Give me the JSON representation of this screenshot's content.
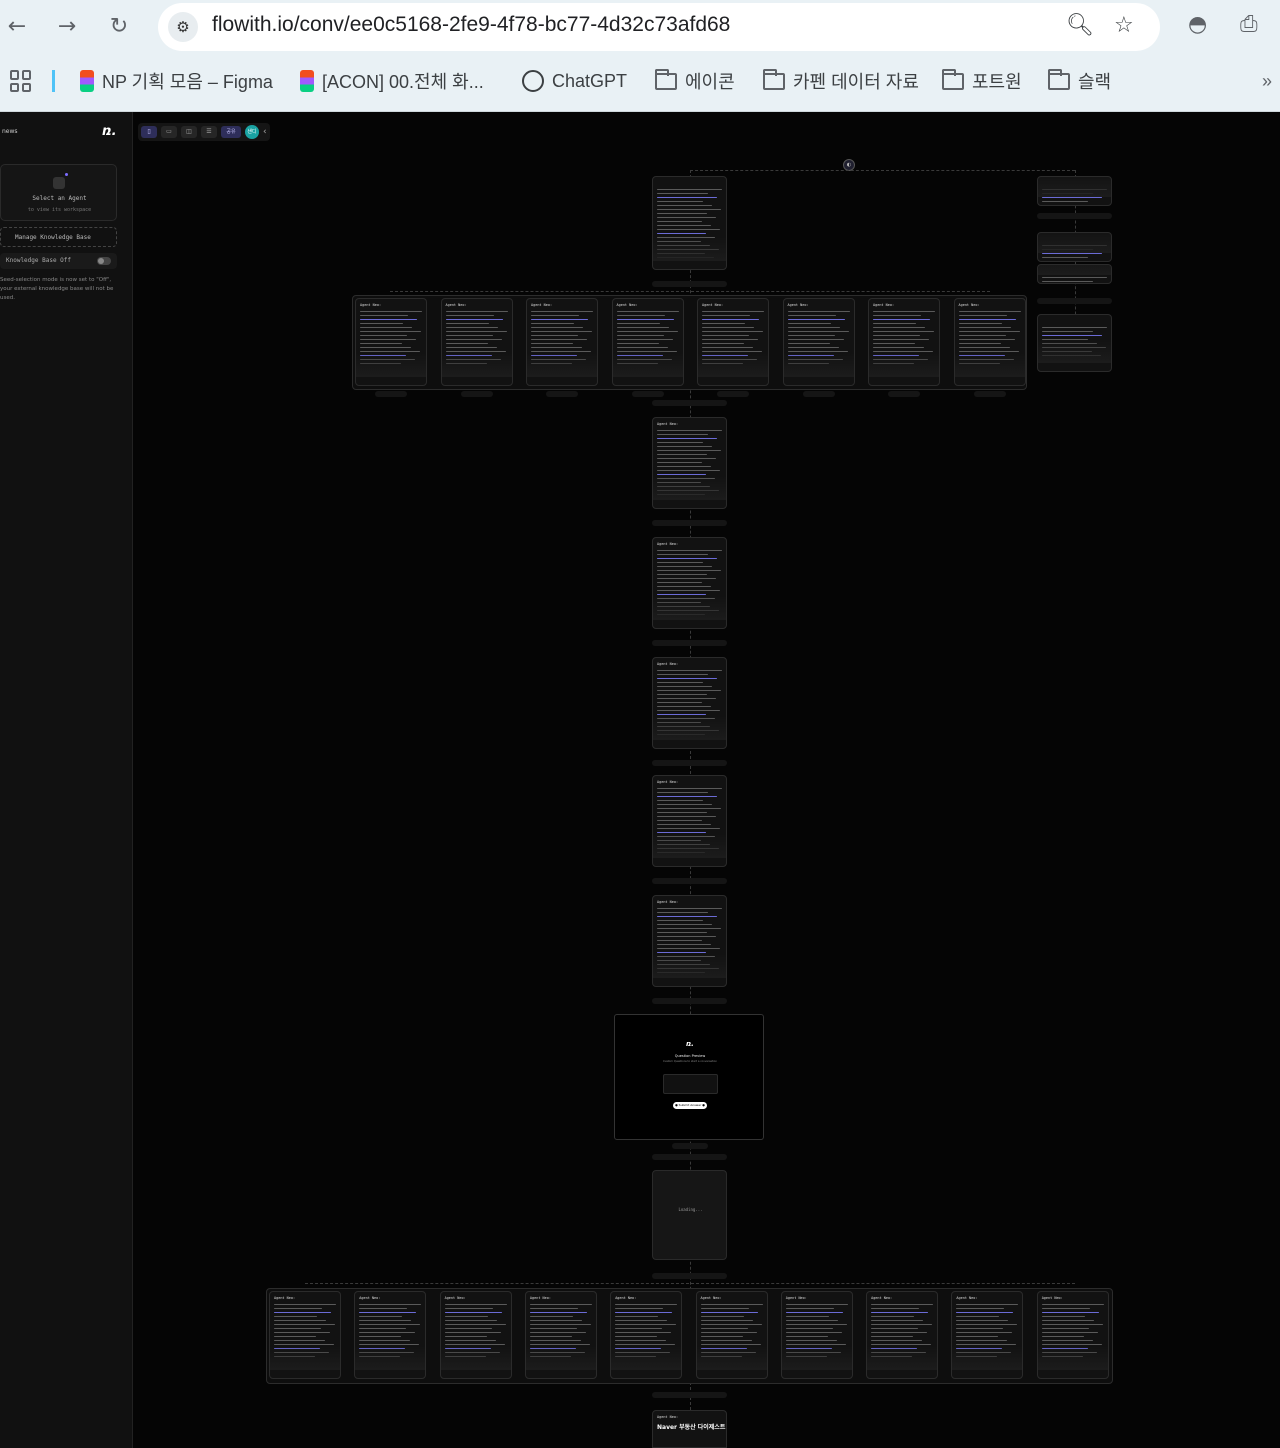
{
  "browser": {
    "url": "flowith.io/conv/ee0c5168-2fe9-4f78-bc77-4d32c73afd68",
    "nav": {
      "back_icon": "arrow-left-icon",
      "forward_icon": "arrow-right-icon",
      "reload_icon": "reload-icon"
    },
    "bookmarks": [
      {
        "label": "NP 기획 모음 – Figma",
        "icon": "figma-icon"
      },
      {
        "label": "[ACON] 00.전체 화...",
        "icon": "figma-icon"
      },
      {
        "label": "ChatGPT",
        "icon": "chatgpt-icon"
      },
      {
        "label": "에이콘",
        "icon": "folder-icon"
      },
      {
        "label": "카펜 데이터 자료",
        "icon": "folder-icon"
      },
      {
        "label": "포트원",
        "icon": "folder-icon"
      },
      {
        "label": "슬랙",
        "icon": "folder-icon"
      }
    ],
    "overflow": "»"
  },
  "sidebar": {
    "title": "news",
    "logo": "ռ.",
    "agent_card": {
      "title": "Select an Agent",
      "subtitle": "to view its workspace"
    },
    "kb_button": "Manage Knowledge Base",
    "kb_toggle": "Knowledge Base Off",
    "note": "Seed-selection mode is now set to \"Off\", your external knowledge base will not be used."
  },
  "canvas": {
    "toolbar": {
      "share_label": "공유",
      "avatar_label": "샌디",
      "collapse_icon": "chevron-left-icon"
    },
    "node_header": "Agent Neo:",
    "preview": {
      "logo": "ռ.",
      "title": "Question Preview",
      "subtitle": "Custom Questions to start a conversation",
      "button": "● Submit Answer ●"
    },
    "loading_text": "Loading...",
    "final_title": "Naver 부동산 다이제스트"
  },
  "colors": {
    "accent": "#6b6bd6",
    "canvas_bg": "#050505",
    "node_bg": "#121212"
  }
}
